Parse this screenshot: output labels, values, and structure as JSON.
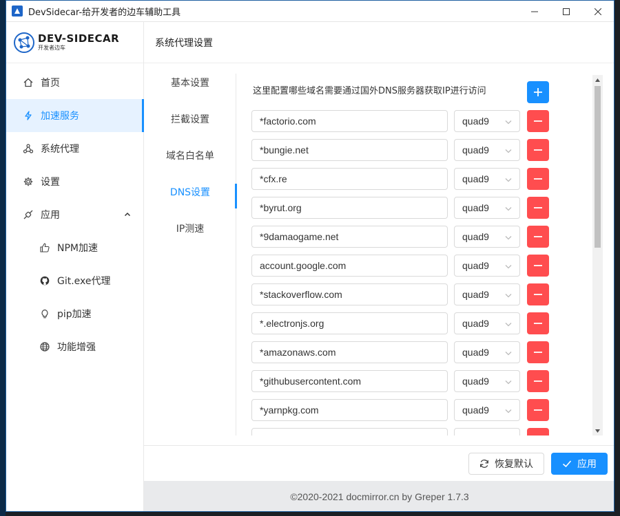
{
  "window": {
    "title": "DevSidecar-给开发者的边车辅助工具",
    "controls": [
      "minimize-icon",
      "maximize-icon",
      "close-icon"
    ]
  },
  "logo": {
    "title": "DEV-SIDECAR",
    "subtitle": "开发者边车"
  },
  "sidebar": {
    "items": [
      {
        "label": "首页",
        "icon": "home-icon"
      },
      {
        "label": "加速服务",
        "icon": "lightning-icon",
        "active": true
      },
      {
        "label": "系统代理",
        "icon": "network-icon"
      },
      {
        "label": "设置",
        "icon": "gear-icon"
      },
      {
        "label": "应用",
        "icon": "api-icon",
        "expanded": true
      },
      {
        "label": "NPM加速",
        "icon": "thumbs-up-icon"
      },
      {
        "label": "Git.exe代理",
        "icon": "github-icon"
      },
      {
        "label": "pip加速",
        "icon": "bulb-icon"
      },
      {
        "label": "功能增强",
        "icon": "globe-icon"
      }
    ]
  },
  "header": {
    "title": "系统代理设置"
  },
  "tabs": [
    {
      "label": "基本设置"
    },
    {
      "label": "拦截设置"
    },
    {
      "label": "域名白名单"
    },
    {
      "label": "DNS设置",
      "active": true
    },
    {
      "label": "IP测速"
    }
  ],
  "dns": {
    "description": "这里配置哪些域名需要通过国外DNS服务器获取IP进行访问",
    "rows": [
      {
        "domain": "*factorio.com",
        "server": "quad9"
      },
      {
        "domain": "*bungie.net",
        "server": "quad9"
      },
      {
        "domain": "*cfx.re",
        "server": "quad9"
      },
      {
        "domain": "*byrut.org",
        "server": "quad9"
      },
      {
        "domain": "*9damaogame.net",
        "server": "quad9"
      },
      {
        "domain": "account.google.com",
        "server": "quad9"
      },
      {
        "domain": "*stackoverflow.com",
        "server": "quad9"
      },
      {
        "domain": "*.electronjs.org",
        "server": "quad9"
      },
      {
        "domain": "*amazonaws.com",
        "server": "quad9"
      },
      {
        "domain": "*githubusercontent.com",
        "server": "quad9"
      },
      {
        "domain": "*yarnpkg.com",
        "server": "quad9"
      },
      {
        "domain": "",
        "server": ""
      }
    ]
  },
  "footer": {
    "reset_label": "恢复默认",
    "apply_label": "应用",
    "copyright": "©2020-2021 docmirror.cn by Greper 1.7.3"
  },
  "colors": {
    "primary": "#1890ff",
    "danger": "#ff4d4f",
    "active_bg": "#e6f2ff"
  }
}
